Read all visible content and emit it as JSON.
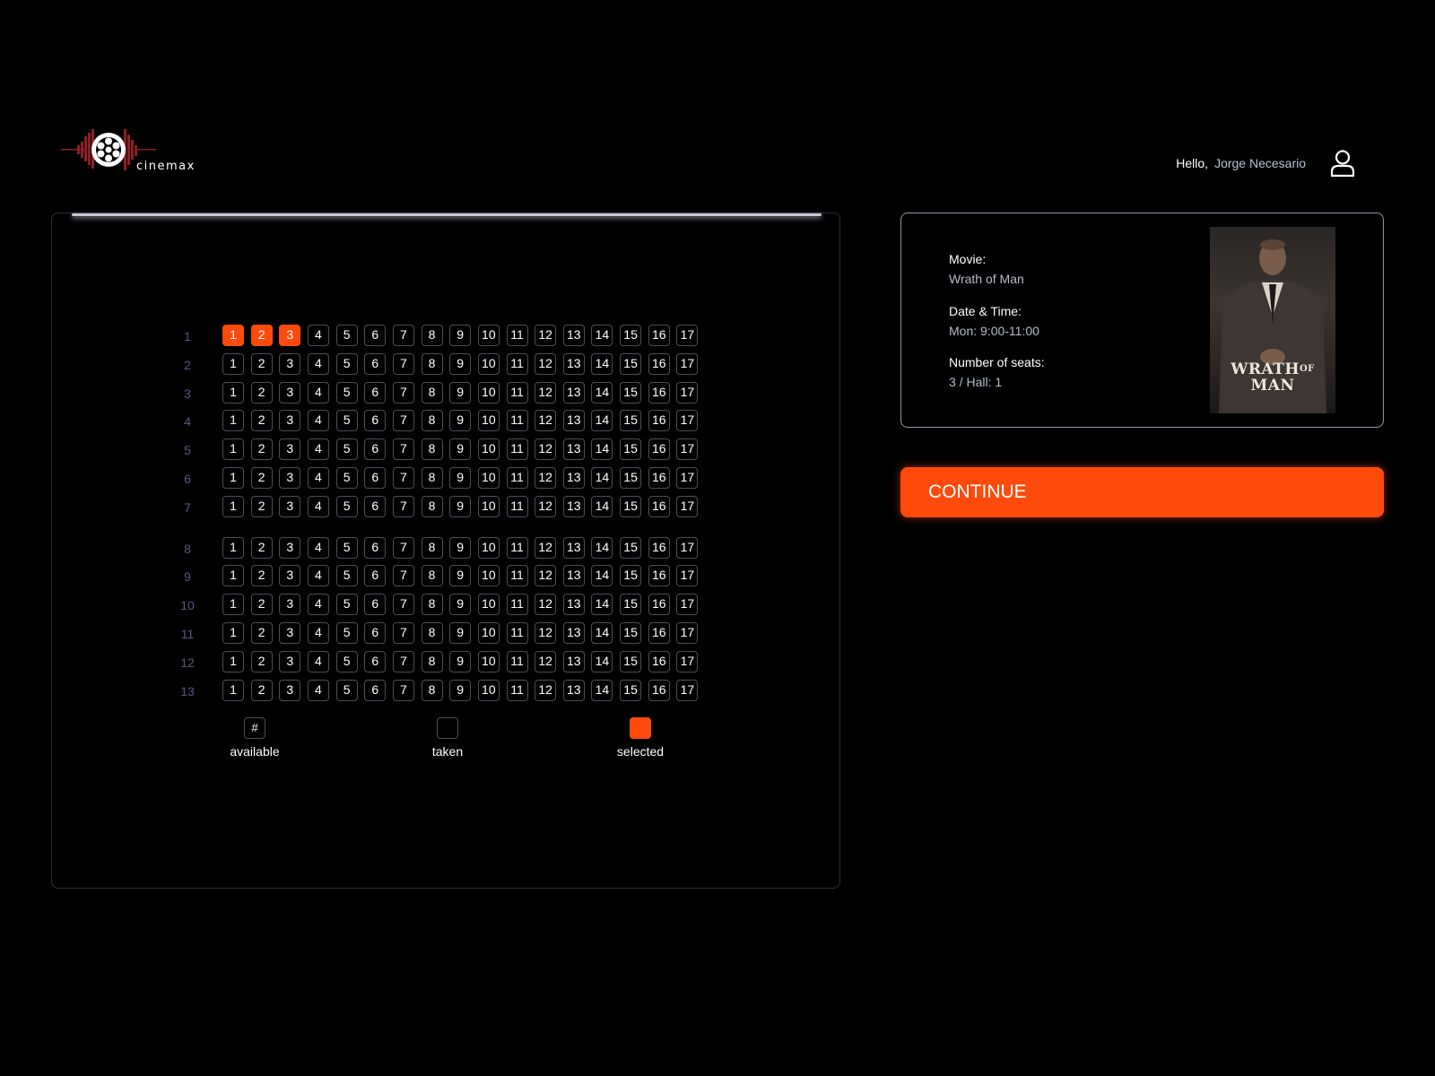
{
  "brand": {
    "logo_text": "cinemax"
  },
  "header": {
    "hello": "Hello,",
    "user_name": "Jorge Necesario"
  },
  "seat_map": {
    "rows": [
      "1",
      "2",
      "3",
      "4",
      "5",
      "6",
      "7",
      "8",
      "9",
      "10",
      "11",
      "12",
      "13"
    ],
    "seats_per_row": [
      "1",
      "2",
      "3",
      "4",
      "5",
      "6",
      "7",
      "8",
      "9",
      "10",
      "11",
      "12",
      "13",
      "14",
      "15",
      "16",
      "17"
    ],
    "selected": [
      {
        "row": "1",
        "seat": "1"
      },
      {
        "row": "1",
        "seat": "2"
      },
      {
        "row": "1",
        "seat": "3"
      }
    ]
  },
  "legend": {
    "available_symbol": "#",
    "available": "available",
    "taken": "taken",
    "selected": "selected"
  },
  "booking": {
    "movie_label": "Movie:",
    "movie": "Wrath of Man",
    "datetime_label": "Date & Time:",
    "datetime": "Mon: 9:00-11:00",
    "seats_label": "Number of seats:",
    "seats": "3 / Hall: 1",
    "poster_title_1": "WRATH",
    "poster_title_of": "OF",
    "poster_title_2": "MAN"
  },
  "actions": {
    "continue": "CONTINUE"
  },
  "colors": {
    "accent": "#fe4a0a",
    "background": "#000000",
    "seat_border": "#4a4e5a",
    "row_label": "#545a7e"
  },
  "icons": {
    "user": "user-icon",
    "logo": "film-reel-icon"
  }
}
